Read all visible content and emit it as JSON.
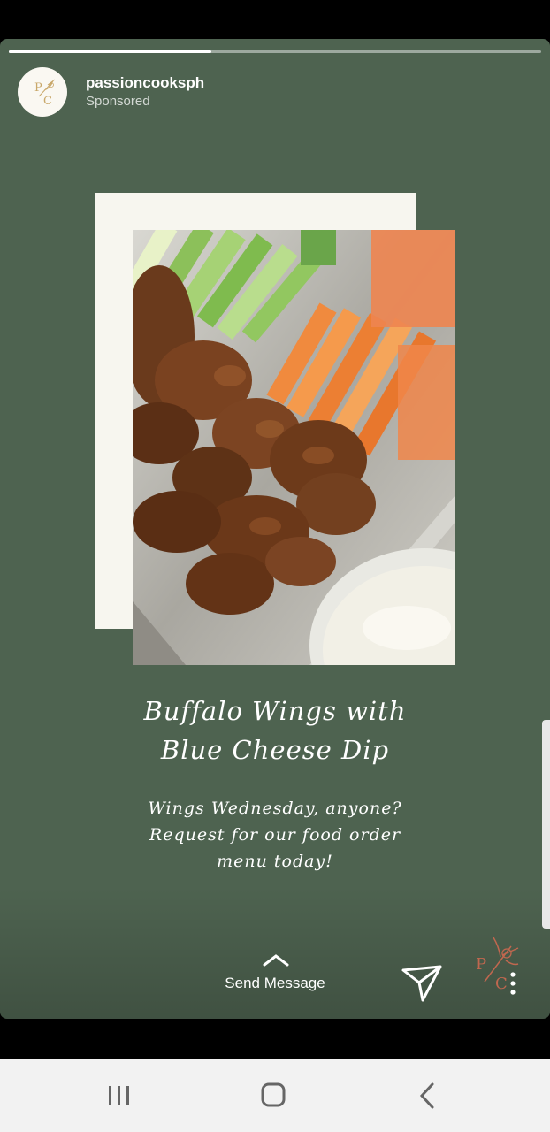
{
  "story": {
    "account": {
      "username": "passioncooksph",
      "label": "Sponsored",
      "avatar_letters": "PC"
    },
    "progress": 0.38,
    "headline": [
      "Buffalo Wings with",
      "Blue Cheese Dip"
    ],
    "caption": [
      "Wings Wednesday, anyone?",
      "Request for our food order",
      "menu today!"
    ],
    "cta": {
      "label": "Send Message",
      "icon": "chevron-up-icon"
    },
    "actions": {
      "share_icon": "paper-plane-icon",
      "more_icon": "more-vertical-icon"
    }
  },
  "system_nav": {
    "buttons": [
      "recent-apps",
      "home",
      "back"
    ]
  },
  "colors": {
    "background": "#4e6350",
    "card": "#f7f6ef",
    "brand_accent": "#c0674f"
  }
}
